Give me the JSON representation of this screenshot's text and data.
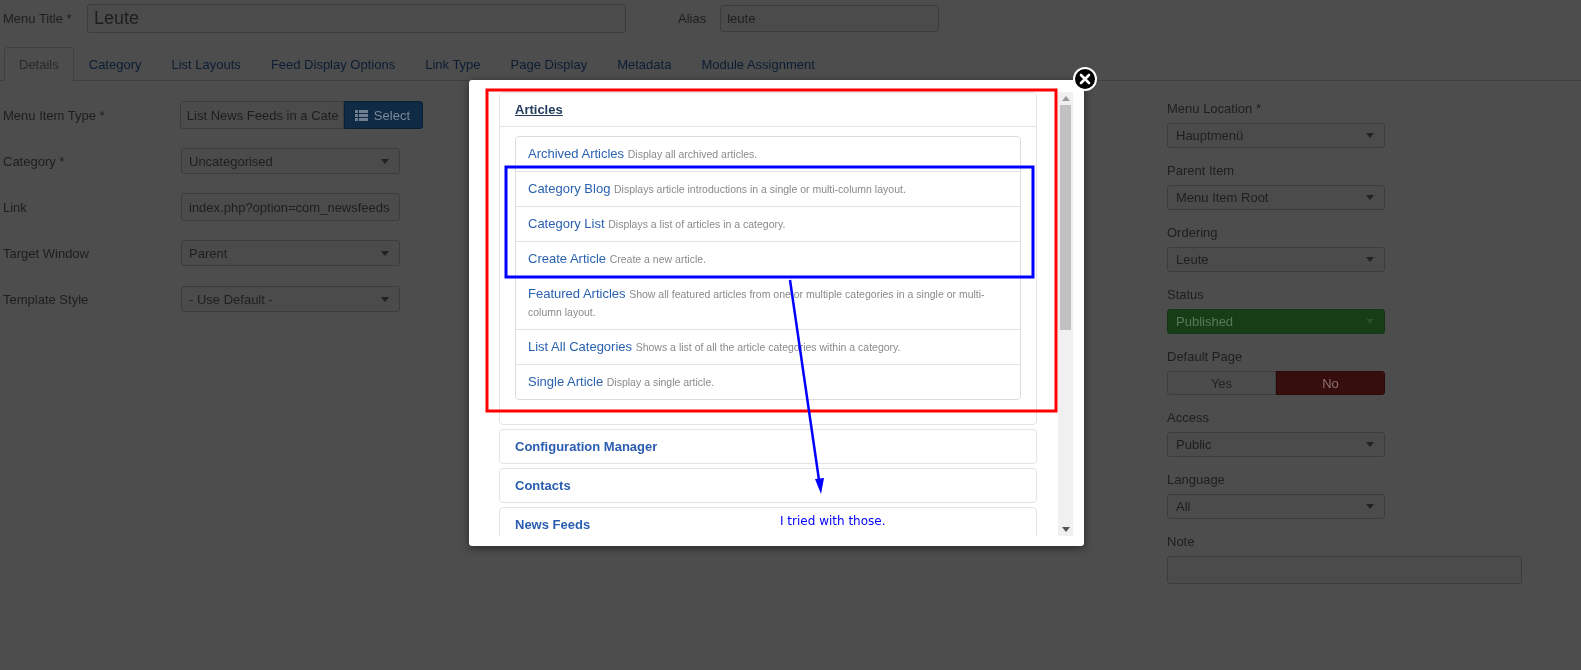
{
  "menu_title": {
    "label": "Menu Title *",
    "value": "Leute"
  },
  "alias": {
    "label": "Alias",
    "value": "leute"
  },
  "tabs": [
    {
      "label": "Details",
      "selected": true
    },
    {
      "label": "Category",
      "selected": false
    },
    {
      "label": "List Layouts",
      "selected": false
    },
    {
      "label": "Feed Display Options",
      "selected": false
    },
    {
      "label": "Link Type",
      "selected": false
    },
    {
      "label": "Page Display",
      "selected": false
    },
    {
      "label": "Metadata",
      "selected": false
    },
    {
      "label": "Module Assignment",
      "selected": false
    }
  ],
  "left_fields": [
    {
      "kind": "picker",
      "label": "Menu Item Type *",
      "value": "List News Feeds in a Cate",
      "button": "Select"
    },
    {
      "kind": "select",
      "label": "Category *",
      "value": "Uncategorised"
    },
    {
      "kind": "input",
      "label": "Link",
      "value": "index.php?option=com_newsfeeds"
    },
    {
      "kind": "select",
      "label": "Target Window",
      "value": "Parent"
    },
    {
      "kind": "select",
      "label": "Template Style",
      "value": "- Use Default -"
    }
  ],
  "right_fields": [
    {
      "kind": "select",
      "label": "Menu Location *",
      "value": "Hauptmenü"
    },
    {
      "kind": "select",
      "label": "Parent Item",
      "value": "Menu Item Root"
    },
    {
      "kind": "select",
      "label": "Ordering",
      "value": "Leute"
    },
    {
      "kind": "status",
      "label": "Status",
      "value": "Published"
    },
    {
      "kind": "toggle",
      "label": "Default Page",
      "options": [
        {
          "label": "Yes",
          "selected": false
        },
        {
          "label": "No",
          "selected": true
        }
      ]
    },
    {
      "kind": "select",
      "label": "Access",
      "value": "Public"
    },
    {
      "kind": "select",
      "label": "Language",
      "value": "All"
    },
    {
      "kind": "textarea",
      "label": "Note"
    }
  ],
  "dialog": {
    "groups": [
      {
        "title": "Articles",
        "expanded": true,
        "items": [
          {
            "title": "Archived Articles",
            "description": "Display all archived articles."
          },
          {
            "title": "Category Blog",
            "description": "Displays article introductions in a single or multi-column layout."
          },
          {
            "title": "Category List",
            "description": "Displays a list of articles in a category."
          },
          {
            "title": "Create Article",
            "description": "Create a new article."
          },
          {
            "title": "Featured Articles",
            "description": "Show all featured articles from one or multiple categories in a single or multi-column layout."
          },
          {
            "title": "List All Categories",
            "description": "Shows a list of all the article categories within a category."
          },
          {
            "title": "Single Article",
            "description": "Display a single article."
          }
        ]
      },
      {
        "title": "Configuration Manager",
        "expanded": false
      },
      {
        "title": "Contacts",
        "expanded": false
      },
      {
        "title": "News Feeds",
        "expanded": false
      }
    ]
  },
  "annotation": {
    "note": "I tried with those."
  }
}
